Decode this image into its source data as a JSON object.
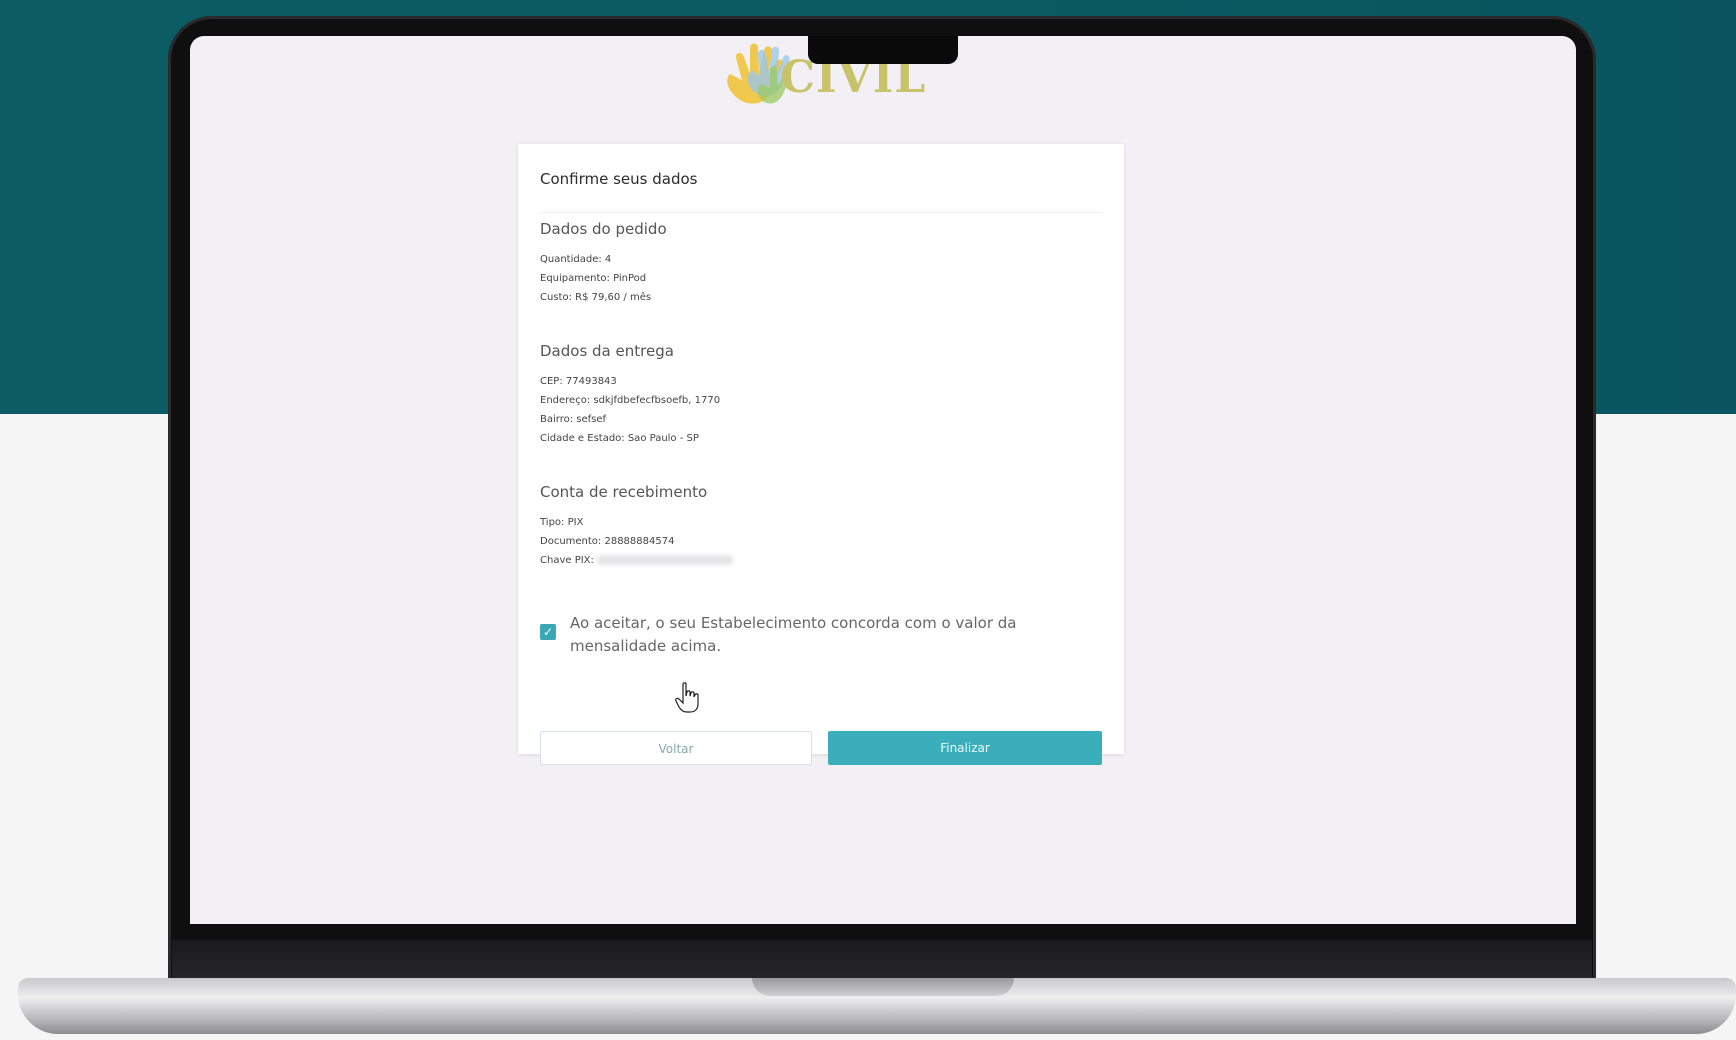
{
  "logo": {
    "text": "CIVIL"
  },
  "card": {
    "title": "Confirme seus dados",
    "order": {
      "heading": "Dados do pedido",
      "lines": [
        "Quantidade: 4",
        "Equipamento: PinPod",
        "Custo: R$ 79,60 / mês"
      ]
    },
    "delivery": {
      "heading": "Dados da entrega",
      "lines": [
        "CEP: 77493843",
        "Endereço: sdkjfdbefecfbsoefb, 1770",
        "Bairro: sefsef",
        "Cidade e Estado: Sao Paulo - SP"
      ]
    },
    "account": {
      "heading": "Conta de recebimento",
      "lines": [
        "Tipo: PIX",
        "Documento: 28888884574",
        "Chave PIX:"
      ]
    },
    "consent": {
      "checked": true,
      "text": "Ao aceitar, o seu Estabelecimento concorda com o valor da mensalidade acima."
    },
    "buttons": {
      "back": "Voltar",
      "finish": "Finalizar"
    }
  },
  "colors": {
    "accent": "#3aafbb",
    "header_bg": "#0b5c63",
    "screen_bg": "#f2f0f5"
  }
}
